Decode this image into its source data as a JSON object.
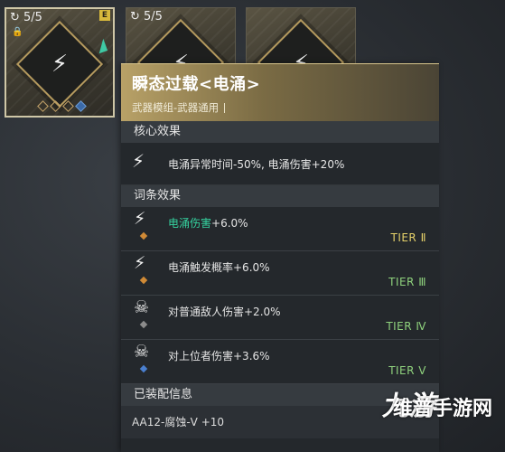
{
  "slots": [
    {
      "count": "5/5",
      "equipped_badge": "E",
      "icon": "surge-lightning-icon",
      "locked": true
    },
    {
      "count": "5/5",
      "icon": "surge-lightning-icon"
    },
    {
      "icon": "surge-lightning-icon"
    }
  ],
  "panel": {
    "title": "瞬态过载<电涌>",
    "subtitle": "武器模组-武器通用",
    "core_section": "核心效果",
    "core_effect": "电涌异常时间-50%, 电涌伤害+20%",
    "entries_section": "词条效果",
    "entries": [
      {
        "highlight": "电涌伤害",
        "rest": "+6.0%",
        "tier": "TIER Ⅱ",
        "gem": "orange"
      },
      {
        "highlight": "",
        "rest": "电涌触发概率+6.0%",
        "tier": "TIER Ⅲ",
        "gem": "orange"
      },
      {
        "highlight": "",
        "rest": "对普通敌人伤害+2.0%",
        "tier": "TIER Ⅳ",
        "gem": "gray"
      },
      {
        "highlight": "",
        "rest": "对上位者伤害+3.6%",
        "tier": "TIER Ⅴ",
        "gem": "blue"
      }
    ],
    "equip_section": "已装配信息",
    "equip_value": "AA12-腐蚀-V +10"
  },
  "watermark": {
    "logo": "九游",
    "site": "维普手游网"
  },
  "colors": {
    "highlight": "#35d3a0",
    "header_gold": "#b8a167",
    "tier_green": "#8fd27d"
  }
}
